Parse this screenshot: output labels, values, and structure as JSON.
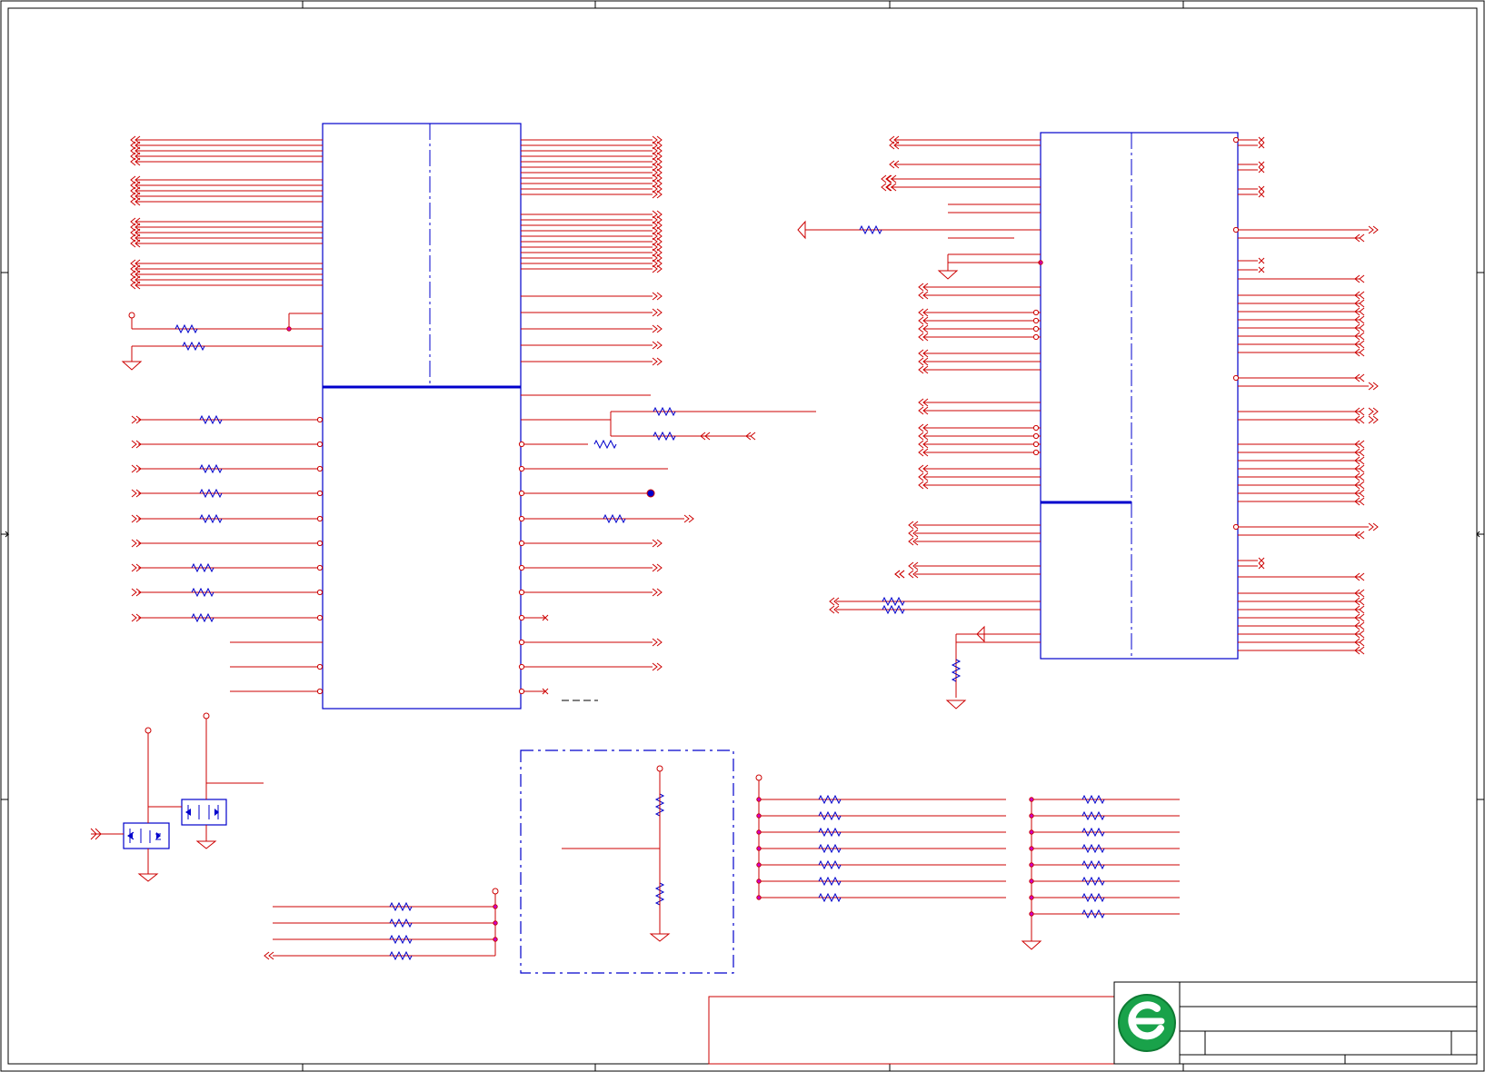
{
  "title_block": {
    "logo": "company-logo",
    "logo_colors": {
      "ring": "#19a24a",
      "mark": "#ffffff"
    }
  },
  "colors": {
    "frame": "#000000",
    "wire": "#cc0000",
    "component_body": "#0000cc",
    "net_junction": "#cc00cc"
  }
}
